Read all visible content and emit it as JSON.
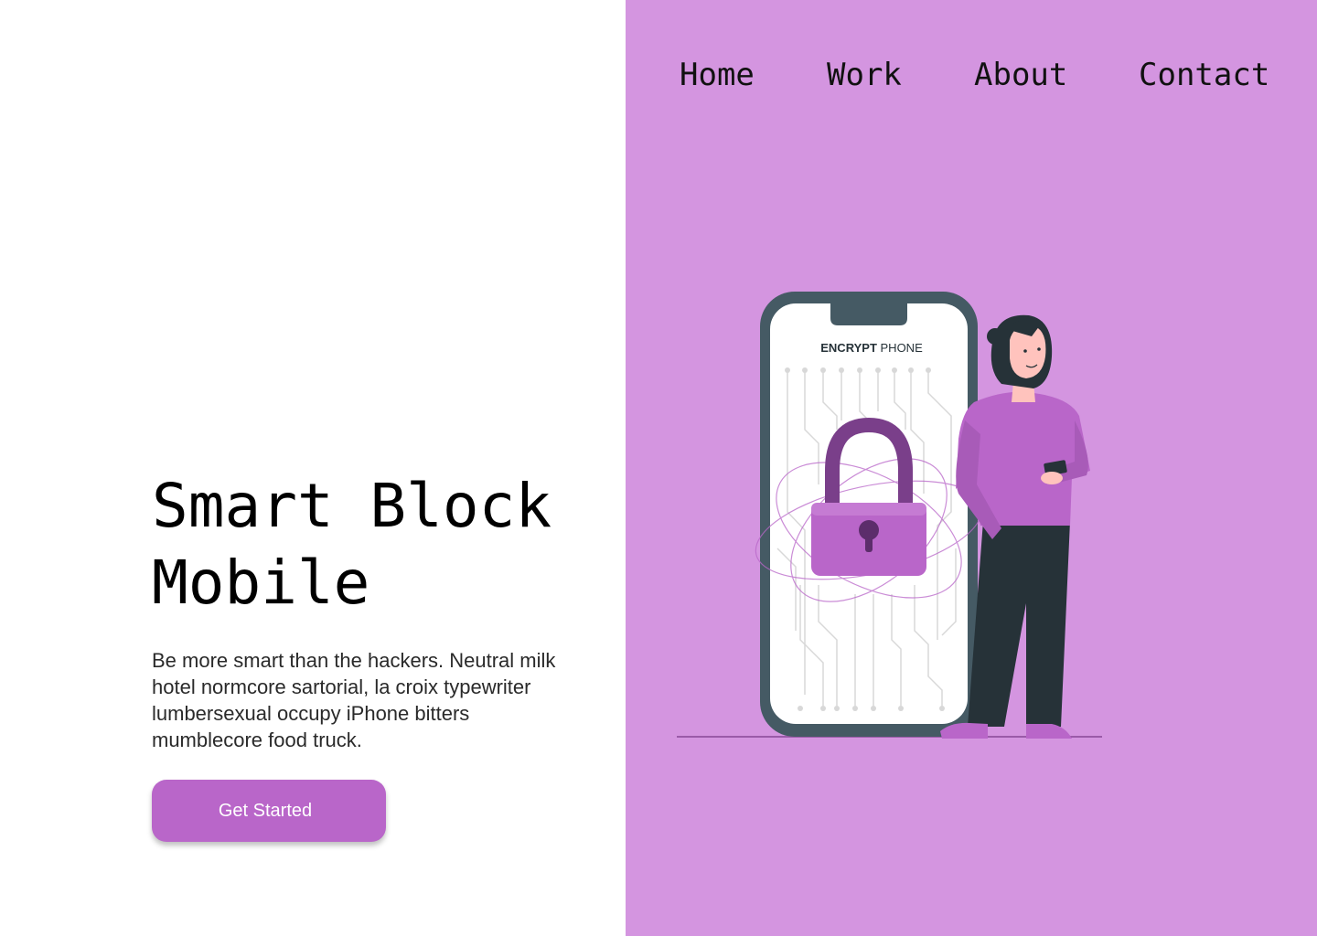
{
  "nav": {
    "items": [
      {
        "label": "Home"
      },
      {
        "label": "Work"
      },
      {
        "label": "About"
      },
      {
        "label": "Contact"
      }
    ]
  },
  "hero": {
    "title_line1": "Smart Block",
    "title_line2": "Mobile",
    "description": "Be more smart than the hackers. Neutral milk hotel normcore sartorial, la croix typewriter lumbersexual  occupy iPhone bitters mumblecore food truck.",
    "cta_label": "Get Started"
  },
  "illustration": {
    "screen_label_bold": "ENCRYPT",
    "screen_label_regular": "PHONE",
    "icon": "padlock-icon"
  },
  "colors": {
    "accent": "#b966c9",
    "panel": "#d495e0",
    "phone_frame": "#455a64",
    "pants": "#263238"
  }
}
